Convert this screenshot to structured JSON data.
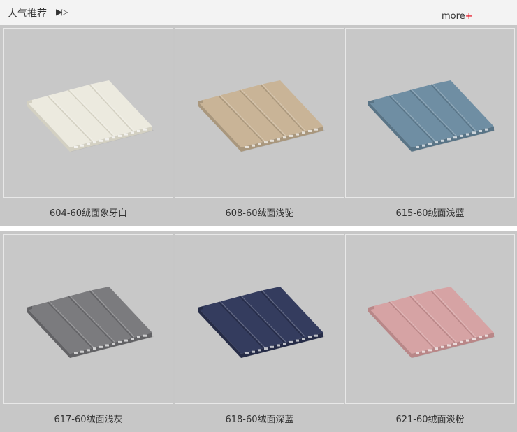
{
  "header": {
    "title": "人气推荐",
    "arrows": "▶▷",
    "more_label": "more",
    "more_plus": "+"
  },
  "products": [
    {
      "caption": "604-60绒面象牙白",
      "panel_color": "#eceadf",
      "shade_color": "#d3d0c2"
    },
    {
      "caption": "608-60绒面浅驼",
      "panel_color": "#c9b497",
      "shade_color": "#a9977d"
    },
    {
      "caption": "615-60绒面浅蓝",
      "panel_color": "#6f8ea3",
      "shade_color": "#597486"
    },
    {
      "caption": "617-60绒面浅灰",
      "panel_color": "#7b7b7e",
      "shade_color": "#626265"
    },
    {
      "caption": "618-60绒面深蓝",
      "panel_color": "#343c5e",
      "shade_color": "#262c47"
    },
    {
      "caption": "621-60绒面淡粉",
      "panel_color": "#d6a3a4",
      "shade_color": "#b98788"
    }
  ]
}
